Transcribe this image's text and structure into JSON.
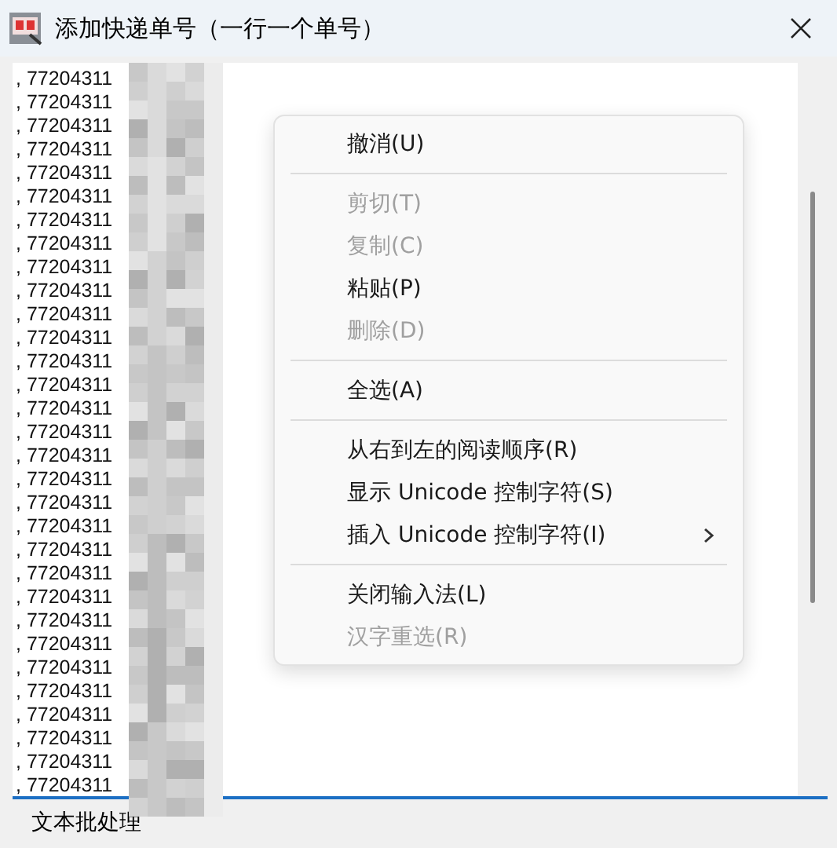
{
  "window": {
    "title": "添加快递单号（一行一个单号）"
  },
  "editor": {
    "lines": [
      ", 77204311",
      ", 77204311",
      ", 77204311",
      ", 77204311",
      ", 77204311",
      ", 77204311",
      ", 77204311",
      ", 77204311",
      ", 77204311",
      ", 77204311",
      ", 77204311",
      ", 77204311",
      ", 77204311",
      ", 77204311",
      ", 77204311",
      ", 77204311",
      ", 77204311",
      ", 77204311",
      ", 77204311",
      ", 77204311",
      ", 77204311",
      ", 77204311",
      ", 77204311",
      ", 77204311",
      ", 77204311",
      ", 77204311",
      ", 77204311",
      ", 77204311",
      ", 77204311",
      ", 77204311",
      ", 77204311"
    ]
  },
  "context_menu": {
    "items": [
      {
        "kind": "item",
        "label": "撤消(U)",
        "disabled": false
      },
      {
        "kind": "separator"
      },
      {
        "kind": "item",
        "label": "剪切(T)",
        "disabled": true
      },
      {
        "kind": "item",
        "label": "复制(C)",
        "disabled": true
      },
      {
        "kind": "item",
        "label": "粘贴(P)",
        "disabled": false
      },
      {
        "kind": "item",
        "label": "删除(D)",
        "disabled": true
      },
      {
        "kind": "separator"
      },
      {
        "kind": "item",
        "label": "全选(A)",
        "disabled": false
      },
      {
        "kind": "separator"
      },
      {
        "kind": "item",
        "label": "从右到左的阅读顺序(R)",
        "disabled": false
      },
      {
        "kind": "item",
        "label": "显示 Unicode 控制字符(S)",
        "disabled": false
      },
      {
        "kind": "submenu",
        "label": "插入 Unicode 控制字符(I)",
        "disabled": false
      },
      {
        "kind": "separator"
      },
      {
        "kind": "item",
        "label": "关闭输入法(L)",
        "disabled": false
      },
      {
        "kind": "item",
        "label": "汉字重选(R)",
        "disabled": true
      }
    ]
  },
  "group": {
    "label": "文本批处理"
  }
}
